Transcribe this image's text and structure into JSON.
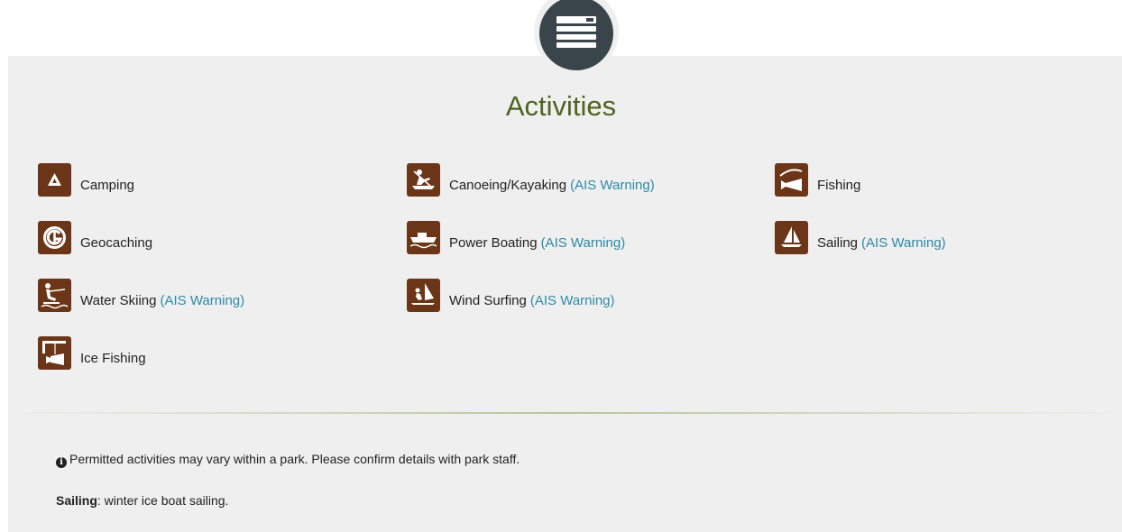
{
  "header": {
    "icon": "list-icon",
    "title": "Activities"
  },
  "activities": [
    {
      "label": "Camping",
      "icon": "camping-icon",
      "warning": ""
    },
    {
      "label": "Canoeing/Kayaking",
      "icon": "canoeing-icon",
      "warning": "(AIS Warning)"
    },
    {
      "label": "Fishing",
      "icon": "fishing-icon",
      "warning": ""
    },
    {
      "label": "Geocaching",
      "icon": "geocaching-icon",
      "warning": ""
    },
    {
      "label": "Power Boating",
      "icon": "power-boating-icon",
      "warning": "(AIS Warning)"
    },
    {
      "label": "Sailing",
      "icon": "sailing-icon",
      "warning": "(AIS Warning)"
    },
    {
      "label": "Water Skiing",
      "icon": "water-skiing-icon",
      "warning": "(AIS Warning)"
    },
    {
      "label": "Wind Surfing",
      "icon": "wind-surfing-icon",
      "warning": "(AIS Warning)"
    },
    {
      "label": "Ice Fishing",
      "icon": "ice-fishing-icon",
      "warning": ""
    }
  ],
  "notes": {
    "info_icon": "info-icon",
    "permitted": "Permitted activities may vary within a park. Please confirm details with park staff.",
    "sailing_label": "Sailing",
    "sailing_text": ": winter ice boat sailing."
  },
  "colors": {
    "title": "#4f6320",
    "icon_bg": "#6b3618",
    "link": "#2b8aa8",
    "panel": "#efefef",
    "header_circle": "#3a444b"
  }
}
